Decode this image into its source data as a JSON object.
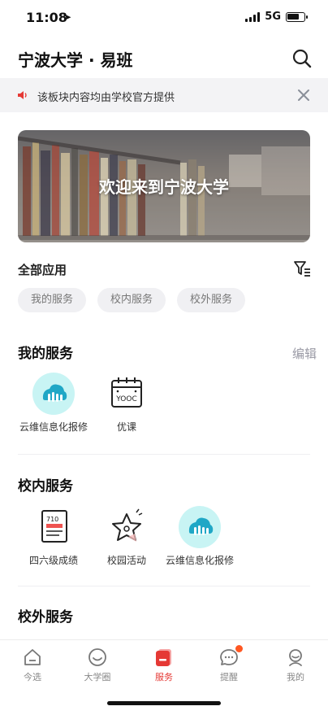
{
  "status_bar": {
    "time": "11:08",
    "network": "5G",
    "battery_level": 0.7
  },
  "header": {
    "title": "宁波大学 · 易班",
    "search_icon": "search-icon"
  },
  "notice": {
    "text": "该板块内容均由学校官方提供",
    "icon": "speaker-icon",
    "close_icon": "close-icon",
    "accent": "#e53935"
  },
  "banner": {
    "text": "欢迎来到宁波大学"
  },
  "all_apps": {
    "label": "全部应用",
    "filter_icon": "filter-icon",
    "chips": [
      "我的服务",
      "校内服务",
      "校外服务"
    ]
  },
  "my_services": {
    "title": "我的服务",
    "edit_label": "编辑",
    "apps": [
      {
        "label": "云维信息化报修",
        "icon": "cloud-repair-icon"
      },
      {
        "label": "优课",
        "icon": "yooc-calendar-icon",
        "icon_text": "YOOC"
      }
    ]
  },
  "campus_services": {
    "title": "校内服务",
    "apps": [
      {
        "label": "四六级成绩",
        "icon": "exam-report-icon",
        "icon_text": "710"
      },
      {
        "label": "校园活动",
        "icon": "star-icon"
      },
      {
        "label": "云维信息化报修",
        "icon": "cloud-repair-icon"
      }
    ]
  },
  "external_services": {
    "title": "校外服务"
  },
  "tabbar": {
    "items": [
      {
        "label": "今选",
        "icon": "home-icon",
        "active": false
      },
      {
        "label": "大学圈",
        "icon": "smile-icon",
        "active": false
      },
      {
        "label": "服务",
        "icon": "service-icon",
        "active": true
      },
      {
        "label": "提醒",
        "icon": "chat-bubble-icon",
        "active": false,
        "badge": true
      },
      {
        "label": "我的",
        "icon": "profile-icon",
        "active": false
      }
    ],
    "active_color": "#e53935"
  }
}
